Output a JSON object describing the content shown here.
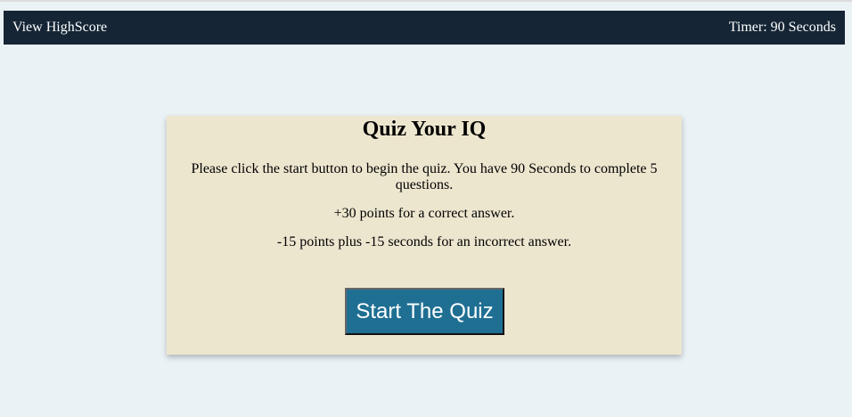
{
  "header": {
    "highscore_link": "View HighScore",
    "timer": "Timer: 90 Seconds"
  },
  "card": {
    "title": "Quiz Your IQ",
    "intro": "Please click the start button to begin the quiz. You have 90 Seconds to complete 5 questions.",
    "correct_rule": "+30 points for a correct answer.",
    "incorrect_rule": "-15 points plus -15 seconds for an incorrect answer.",
    "start_button": "Start The Quiz"
  },
  "colors": {
    "header_bg": "#152535",
    "card_bg": "#ede6cf",
    "button_bg": "#1f6f93",
    "page_bg": "#eaf2f6"
  }
}
